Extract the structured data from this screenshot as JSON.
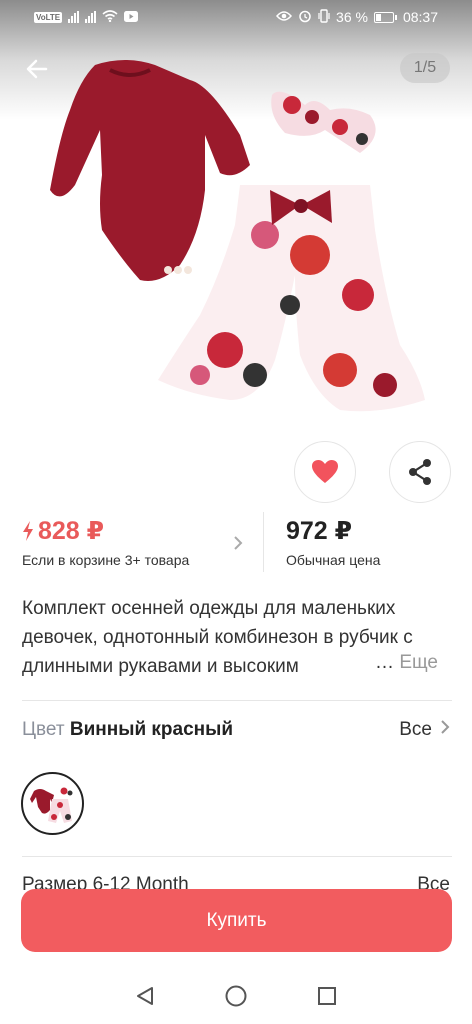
{
  "status_bar": {
    "left_badge": "VoLTE",
    "battery": "36 %",
    "time": "08:37"
  },
  "gallery": {
    "counter": "1/5"
  },
  "price": {
    "promo_price": "828 ₽",
    "promo_caption": "Если в корзине 3+ товара",
    "regular_price": "972 ₽",
    "regular_caption": "Обычная цена"
  },
  "description": {
    "text": "Комплект осенней одежды для маленьких девочек, однотонный комбинезон в рубчик с длинными рукавами и высоким",
    "more_label": "Еще"
  },
  "color": {
    "label": "Цвет",
    "value": "Винный красный",
    "all_label": "Все"
  },
  "size": {
    "label": "Размер 6-12 Month",
    "all_label": "Все"
  },
  "buy_button": "Купить",
  "colors": {
    "accent": "#f25c5f",
    "promo": "#e95a5a",
    "product": "#9a1a2c"
  },
  "icons": [
    "back-arrow-icon",
    "heart-icon",
    "share-icon",
    "lightning-icon",
    "chevron-right-icon",
    "nav-back-icon",
    "nav-home-icon",
    "nav-recents-icon"
  ]
}
